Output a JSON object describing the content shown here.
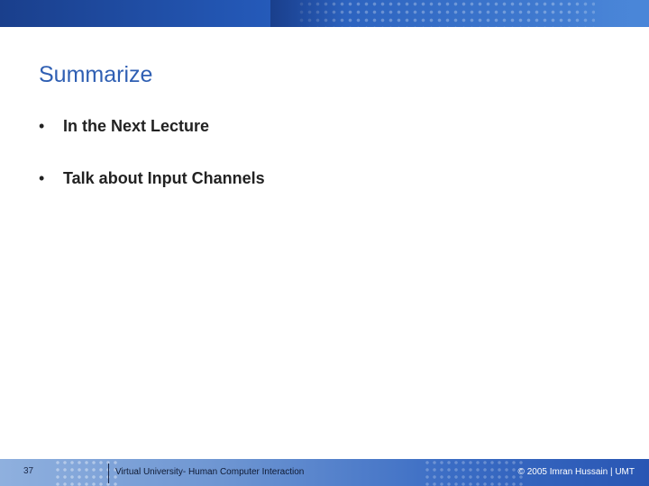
{
  "slide": {
    "title": "Summarize",
    "bullets": [
      {
        "marker": "•",
        "text": "In the Next Lecture"
      },
      {
        "marker": "•",
        "text": "Talk about Input Channels"
      }
    ]
  },
  "footer": {
    "page_number": "37",
    "course": "Virtual University- Human Computer Interaction",
    "copyright": "© 2005 Imran Hussain | UMT"
  },
  "colors": {
    "title": "#2f5fb3",
    "band_dark": "#1a3f8c",
    "band_light": "#4a86d8",
    "text": "#222222"
  }
}
